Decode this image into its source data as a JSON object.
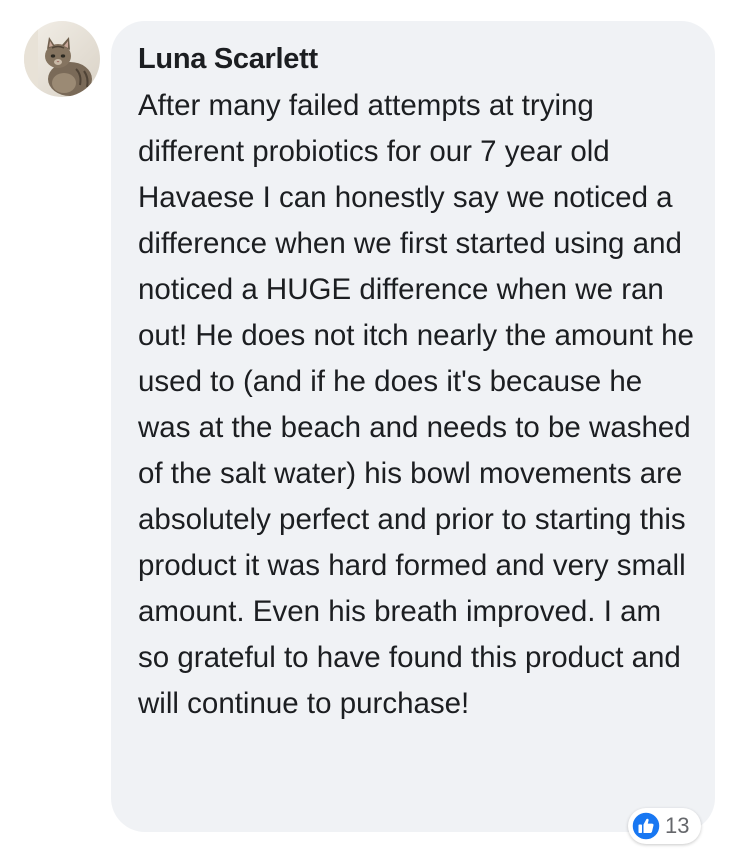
{
  "comment": {
    "author": "Luna Scarlett",
    "text": "After many failed attempts at trying different probiotics for our 7 year old Havaese I can honestly say we noticed a difference when we first started using and noticed a HUGE difference when we ran out! He does not itch nearly the amount he used to (and if he does it's because he was at the beach and needs to be washed of the salt water) his bowl movements are absolutely perfect and prior to starting this product it was hard formed and very small amount. Even his breath improved. I am so grateful to have found this product and will continue to purchase!",
    "reactions": {
      "icon": "like-icon",
      "count": "13"
    }
  },
  "colors": {
    "bubble_background": "#f0f2f5",
    "text": "#1c1e21",
    "like_blue": "#1877f2"
  }
}
